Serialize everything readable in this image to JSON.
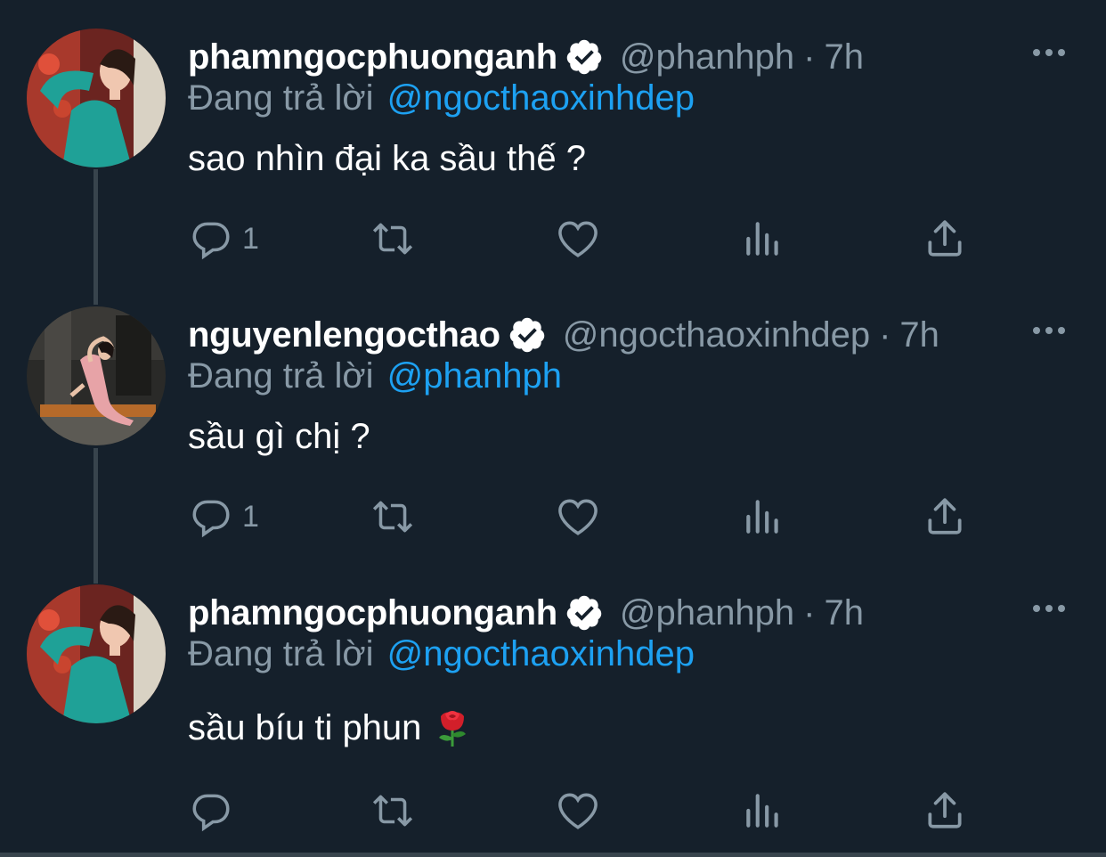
{
  "replying_prefix": "Đang trả lời",
  "tweets": [
    {
      "display_name": "phamngocphuonganh",
      "handle": "@phanhph",
      "separator": "·",
      "time": "7h",
      "reply_to": "@ngocthaoxinhdep",
      "text": "sao nhìn đại ka sầu thế ?",
      "reply_count": "1",
      "icons": [
        "verified-badge-icon",
        "more-icon",
        "reply-icon",
        "retweet-icon",
        "like-icon",
        "analytics-icon",
        "share-icon"
      ]
    },
    {
      "display_name": "nguyenlengocthao",
      "handle": "@ngocthaoxinhdep",
      "separator": "·",
      "time": "7h",
      "reply_to": "@phanhph",
      "text": "sầu gì chị ?",
      "reply_count": "1",
      "icons": [
        "verified-badge-icon",
        "more-icon",
        "reply-icon",
        "retweet-icon",
        "like-icon",
        "analytics-icon",
        "share-icon"
      ]
    },
    {
      "display_name": "phamngocphuonganh",
      "handle": "@phanhph",
      "separator": "·",
      "time": "7h",
      "reply_to": "@ngocthaoxinhdep",
      "text": "sầu bíu ti phun",
      "emoji": "rose-emoji",
      "reply_count": "",
      "icons": [
        "verified-badge-icon",
        "more-icon",
        "reply-icon",
        "retweet-icon",
        "like-icon",
        "analytics-icon",
        "share-icon"
      ]
    }
  ],
  "colors": {
    "background": "#15202b",
    "primary_text": "#ffffff",
    "secondary_text": "#8899a6",
    "accent": "#1da1f2",
    "thread_line": "#38444d"
  }
}
